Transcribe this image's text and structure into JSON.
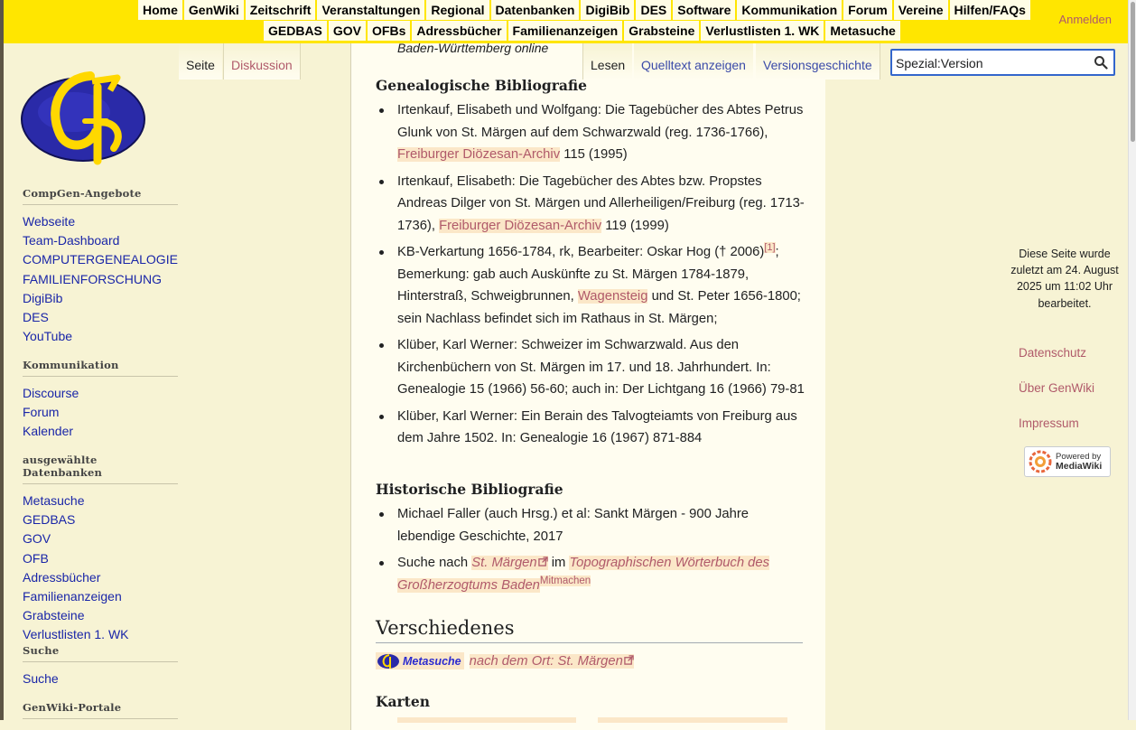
{
  "topnav": {
    "row1": [
      "Home",
      "GenWiki",
      "Zeitschrift",
      "Veranstaltungen",
      "Regional",
      "Datenbanken",
      "DigiBib",
      "DES",
      "Software",
      "Kommunikation",
      "Forum",
      "Vereine",
      "Hilfen/FAQs"
    ],
    "row2": [
      "GEDBAS",
      "GOV",
      "OFBs",
      "Adressbücher",
      "Familienanzeigen",
      "Grabsteine",
      "Verlustlisten 1. WK",
      "Metasuche"
    ],
    "login": "Anmelden"
  },
  "tabs": {
    "seite": "Seite",
    "diskussion": "Diskussion",
    "lesen": "Lesen",
    "quelltext": "Quelltext anzeigen",
    "versionen": "Versionsgeschichte"
  },
  "search": {
    "value": "Spezial:Version"
  },
  "sidebar": {
    "compgen": {
      "title": "CompGen-Angebote",
      "items": [
        "Webseite",
        "Team-Dashboard",
        "COMPUTERGENEALOGIE",
        "FAMILIENFORSCHUNG",
        "DigiBib",
        "DES",
        "YouTube"
      ]
    },
    "kommunikation": {
      "title": "Kommunikation",
      "items": [
        "Discourse",
        "Forum",
        "Kalender"
      ]
    },
    "datenbanken": {
      "title": "ausgewählte Datenbanken",
      "items": [
        "Metasuche",
        "GEDBAS",
        "GOV",
        "OFB",
        "Adressbücher",
        "Familienanzeigen",
        "Grabsteine",
        "Verlustlisten 1. WK"
      ]
    },
    "suche": {
      "title": "Suche",
      "items": [
        "Suche"
      ]
    },
    "portale": {
      "title": "GenWiki-Portale"
    }
  },
  "content": {
    "intro_fragment": "Baden-Württemberg online",
    "gen_bib": {
      "heading": "Genealogische Bibliografie",
      "items": [
        {
          "pre": "Irtenkauf, Elisabeth und Wolfgang: Die Tagebücher des Abtes Petrus Glunk von St. Märgen auf dem Schwarzwald (reg. 1736-1766), ",
          "link": "Freiburger Diözesan-Archiv",
          "post": " 115 (1995)"
        },
        {
          "pre": "Irtenkauf, Elisabeth: Die Tagebücher des Abtes bzw. Propstes Andreas Dilger von St. Märgen und Allerheiligen/Freiburg (reg. 1713-1736), ",
          "link": "Freiburger Diözesan-Archiv",
          "post": " 119 (1999)"
        },
        {
          "pre": "KB-Verkartung 1656-1784, rk, Bearbeiter: Oskar Hog († 2006)",
          "ref": "[1]",
          "mid": "; Bemerkung: gab auch Auskünfte zu St. Märgen 1784-1879, Hinterstraß, Schweigbrunnen, ",
          "link": "Wagensteig",
          "post": " und St. Peter 1656-1800; sein Nachlass befindet sich im Rathaus in St. Märgen;"
        },
        {
          "text": "Klüber, Karl Werner: Schweizer im Schwarzwald. Aus den Kirchenbüchern von St. Märgen im 17. und 18. Jahrhundert. In: Genealogie 15 (1966) 56-60; auch in: Der Lichtgang 16 (1966) 79-81"
        },
        {
          "text": "Klüber, Karl Werner: Ein Berain des Talvogteiamts von Freiburg aus dem Jahre 1502. In: Genealogie 16 (1967) 871-884"
        }
      ]
    },
    "hist_bib": {
      "heading": "Historische Bibliografie",
      "item1": "Michael Faller (auch Hrsg.) et al: Sankt Märgen - 900 Jahre lebendige Geschichte, 2017",
      "item2": {
        "pre": "Suche nach ",
        "link1": "St. Märgen",
        "mid": " im ",
        "link2": "Topographischen Wörterbuch des Großherzogtums Baden",
        "sup": "Mitmachen"
      }
    },
    "verschiedenes": {
      "heading": "Verschiedenes",
      "meta_label": "Metasuche",
      "ort_link": "nach dem Ort: St. Märgen"
    },
    "karten": {
      "heading": "Karten"
    }
  },
  "footer": {
    "lastmod": "Diese Seite wurde zuletzt am 24. August 2025 um 11:02 Uhr bearbeitet.",
    "links": [
      "Datenschutz",
      "Über GenWiki",
      "Impressum"
    ],
    "powered_by": "Powered by",
    "mediawiki": "MediaWiki"
  },
  "colors": {
    "topbar": "#ffe600",
    "background": "#f7f3d4",
    "content_bg": "#fffdf0",
    "link": "#1a26a8",
    "ext_link": "#b05a6a"
  }
}
